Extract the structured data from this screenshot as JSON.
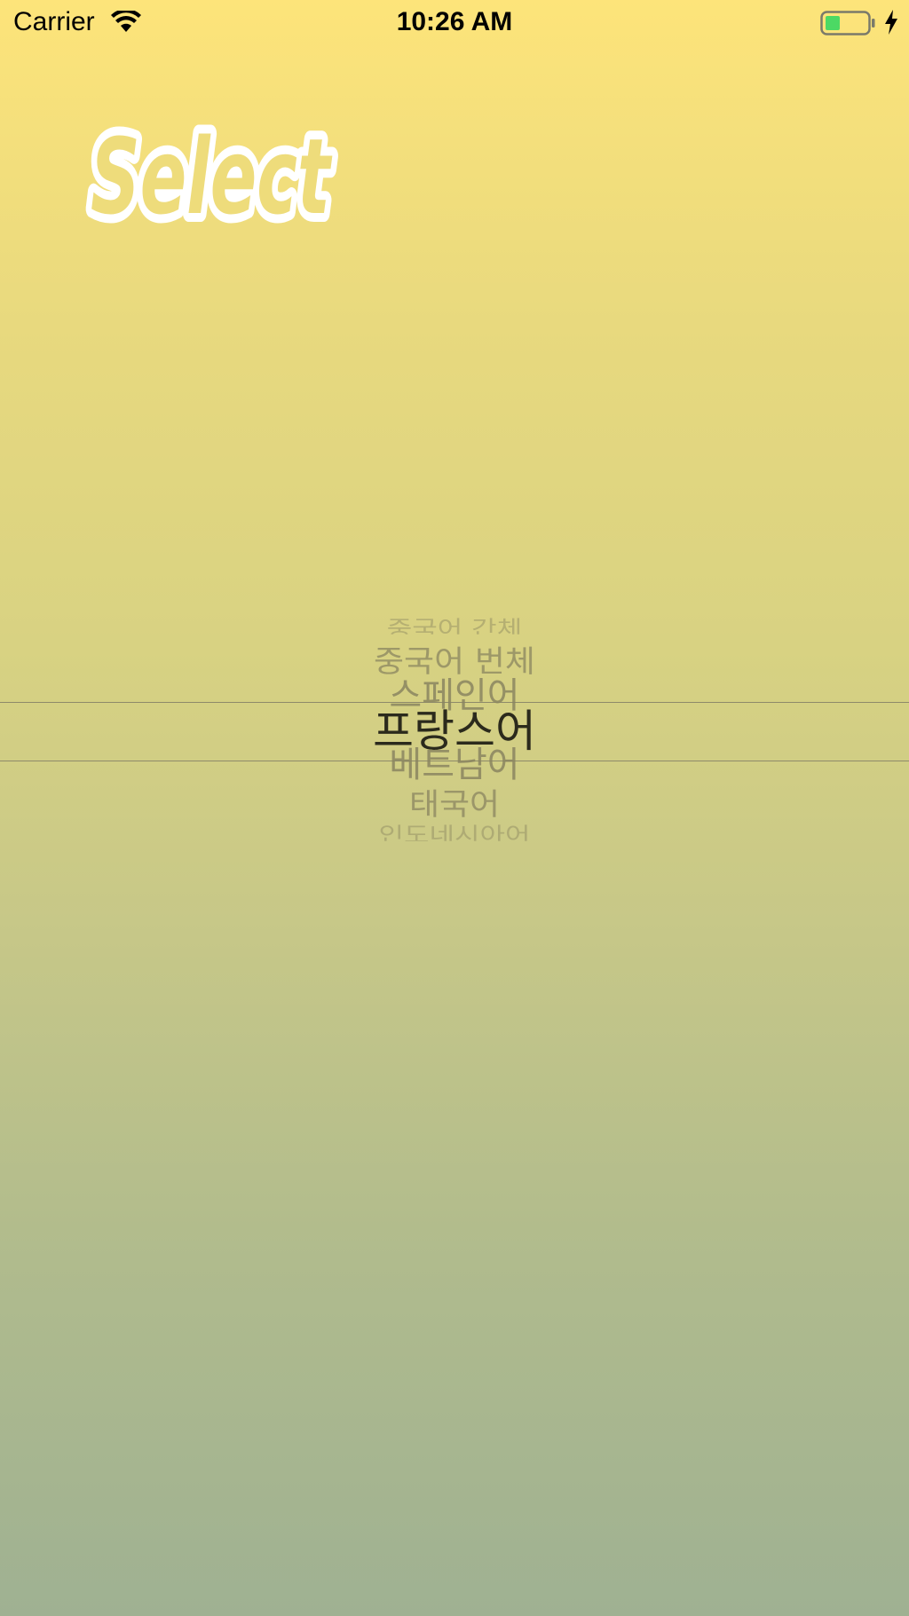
{
  "status_bar": {
    "carrier": "Carrier",
    "time": "10:26 AM",
    "battery_color": "#4cd964"
  },
  "logo": {
    "text": "Select",
    "fill_color": "#ffffff"
  },
  "picker": {
    "items": [
      {
        "label": "중국어 간체",
        "state": "far"
      },
      {
        "label": "중국어 번체",
        "state": "near"
      },
      {
        "label": "스페인어",
        "state": "near"
      },
      {
        "label": "프랑스어",
        "state": "selected"
      },
      {
        "label": "베트남어",
        "state": "near"
      },
      {
        "label": "태국어",
        "state": "near"
      },
      {
        "label": "인도네시아어",
        "state": "far"
      }
    ],
    "selected_index": 3,
    "selected_color": "#2b2a1c",
    "unselected_color": "#8a8560"
  }
}
